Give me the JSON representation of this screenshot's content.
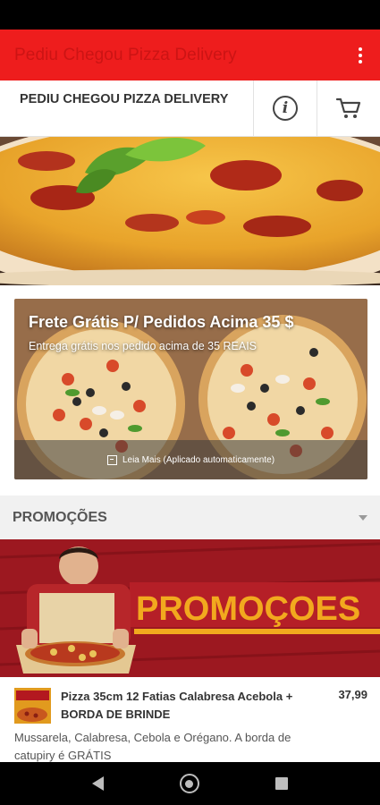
{
  "app_bar": {
    "title": "Pediu Chegou Pizza Delivery"
  },
  "store": {
    "name": "PEDIU CHEGOU PIZZA DELIVERY"
  },
  "promo_banner": {
    "title": "Frete Grátis P/ Pedidos Acima 35 $",
    "subtitle": "Entrega grátis nos pedido acima de 35 REAIS",
    "footer": "Leia Mais (Aplicado automaticamente)"
  },
  "section": {
    "title": "PROMOÇÕES"
  },
  "promo_image": {
    "headline": "PROMOÇOES"
  },
  "product": {
    "name": "Pizza 35cm 12 Fatias Calabresa Acebola + BORDA DE BRINDE",
    "price": "37,99",
    "description": "Mussarela, Calabresa, Cebola e Orégano. A borda de catupiry é GRÁTIS"
  },
  "colors": {
    "accent": "#ee1d1d",
    "title_text": "#cc1414"
  }
}
